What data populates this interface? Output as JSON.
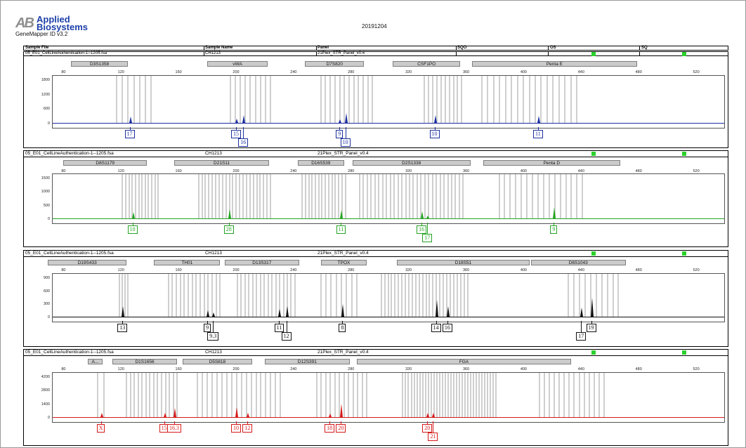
{
  "app": {
    "logo_mark": "AB",
    "brand_line1": "Applied",
    "brand_line2": "Biosystems",
    "software": "GeneMapper ID v3.2",
    "run_title": "20191204"
  },
  "header": {
    "columns": [
      "Sample File",
      "Sample Name",
      "Panel",
      "SQO",
      "OS",
      "SQ"
    ],
    "sample_file": "05_E01_CellLineAuthentication-1--1205.fsa",
    "sample_name": "CH1213",
    "panel": "21Plex_STR_Panel_v0.4"
  },
  "colors": {
    "blue": "#1c2fa0",
    "green": "#24a524",
    "black": "#111111",
    "red": "#d51a1a",
    "status_ok": "#2bd12b",
    "bin": "#cfcfcf"
  },
  "x_axis": {
    "ticks": [
      80,
      120,
      160,
      200,
      240,
      280,
      320,
      360,
      400,
      440,
      480,
      520
    ]
  },
  "panels": [
    {
      "dye": "blue",
      "sample_file": "05_E01_CellLineAuthentication-1--1205.fsa",
      "sample_name": "CH1213",
      "panel": "21Plex_STR_Panel_v0.4",
      "markers": [
        "D3S1358",
        "vWA",
        "D7S820",
        "CSF1PO",
        "Penta E"
      ],
      "y_ticks": [
        1800,
        1200,
        600,
        0
      ],
      "alleles": [
        {
          "label": "17",
          "size": 126
        },
        {
          "label": "15",
          "size": 200
        },
        {
          "label": "16",
          "size": 205
        },
        {
          "label": "9",
          "size": 272
        },
        {
          "label": "10",
          "size": 276
        },
        {
          "label": "10",
          "size": 338
        },
        {
          "label": "11",
          "size": 410
        }
      ]
    },
    {
      "dye": "green",
      "sample_file": "05_E01_CellLineAuthentication-1--1205.fsa",
      "sample_name": "CH1213",
      "panel": "21Plex_STR_Panel_v0.4",
      "markers": [
        "D8S1179",
        "D21S11",
        "D16S539",
        "D2S1338",
        "Penta D"
      ],
      "y_ticks": [
        1500,
        1000,
        500,
        0
      ],
      "alleles": [
        {
          "label": "10",
          "size": 128
        },
        {
          "label": "28",
          "size": 195
        },
        {
          "label": "11",
          "size": 273
        },
        {
          "label": "16",
          "size": 329
        },
        {
          "label": "17",
          "size": 333
        },
        {
          "label": "9",
          "size": 421
        }
      ]
    },
    {
      "dye": "black",
      "sample_file": "05_E01_CellLineAuthentication-1--1205.fsa",
      "sample_name": "CH1213",
      "panel": "21Plex_STR_Panel_v0.4",
      "markers": [
        "D19S433",
        "TH01",
        "D13S317",
        "TPOX",
        "D18S51",
        "D6S1043"
      ],
      "y_ticks": [
        900,
        600,
        300,
        0
      ],
      "alleles": [
        {
          "label": "13",
          "size": 121
        },
        {
          "label": "9",
          "size": 180
        },
        {
          "label": "9.3",
          "size": 184
        },
        {
          "label": "11",
          "size": 230
        },
        {
          "label": "12",
          "size": 235
        },
        {
          "label": "8",
          "size": 274
        },
        {
          "label": "14",
          "size": 339
        },
        {
          "label": "16",
          "size": 347
        },
        {
          "label": "17",
          "size": 440
        },
        {
          "label": "19",
          "size": 447
        }
      ]
    },
    {
      "dye": "red",
      "sample_file": "05_E01_CellLineAuthentication-1--1205.fsa",
      "sample_name": "CH1213",
      "panel": "21Plex_STR_Panel_v0.4",
      "markers": [
        "A...",
        "D1S1656",
        "D5S818",
        "D12S391",
        "FGA"
      ],
      "y_ticks": [
        4200,
        2800,
        1400,
        0
      ],
      "alleles": [
        {
          "label": "X",
          "size": 106
        },
        {
          "label": "15",
          "size": 150
        },
        {
          "label": "16.3",
          "size": 157
        },
        {
          "label": "10",
          "size": 200
        },
        {
          "label": "12",
          "size": 208
        },
        {
          "label": "18",
          "size": 265
        },
        {
          "label": "20",
          "size": 273
        },
        {
          "label": "20",
          "size": 333
        },
        {
          "label": "21",
          "size": 337
        }
      ]
    }
  ]
}
